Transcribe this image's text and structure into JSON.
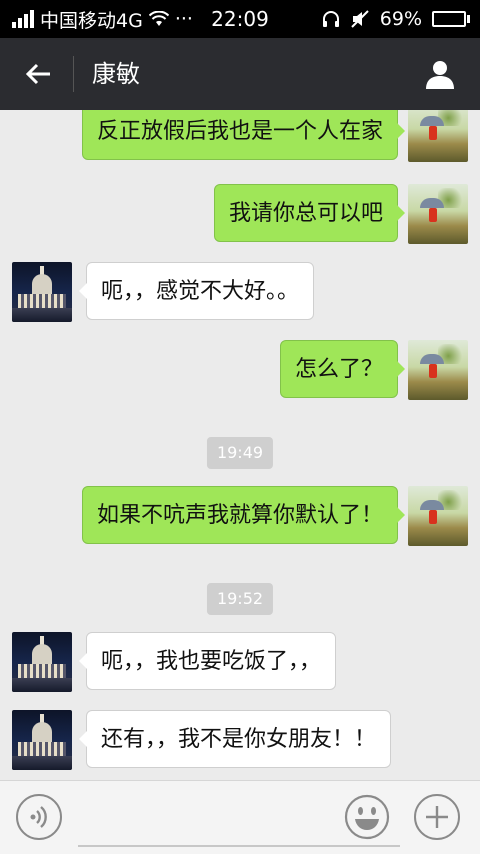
{
  "status_bar": {
    "carrier": "中国移动4G",
    "dots": "···",
    "time": "22:09",
    "battery": "69%",
    "battery_level": 0.69
  },
  "header": {
    "title": "康敏"
  },
  "messages": [
    {
      "from": "me",
      "text": "反正放假后我也是一个人在家"
    },
    {
      "from": "me",
      "text": "我请你总可以吧"
    },
    {
      "from": "other",
      "text": "呃，，感觉不大好。。"
    },
    {
      "from": "me",
      "text": "怎么了？"
    },
    {
      "type": "time",
      "text": "19:49"
    },
    {
      "from": "me",
      "text": "如果不吭声我就算你默认了！"
    },
    {
      "type": "time",
      "text": "19:52"
    },
    {
      "from": "other",
      "text": "呃，，我也要吃饭了，，"
    },
    {
      "from": "other",
      "text": "还有，，我不是你女朋友！！"
    }
  ],
  "input_bar": {
    "placeholder": ""
  },
  "colors": {
    "my_bubble": "#9fe658",
    "other_bubble": "#ffffff",
    "title_bar": "#2b2c30",
    "chat_bg": "#ebebeb"
  },
  "icons": {
    "back": "arrow-left-icon",
    "profile": "person-icon",
    "voice": "voice-icon",
    "emoji": "smiley-icon",
    "more": "plus-icon"
  }
}
